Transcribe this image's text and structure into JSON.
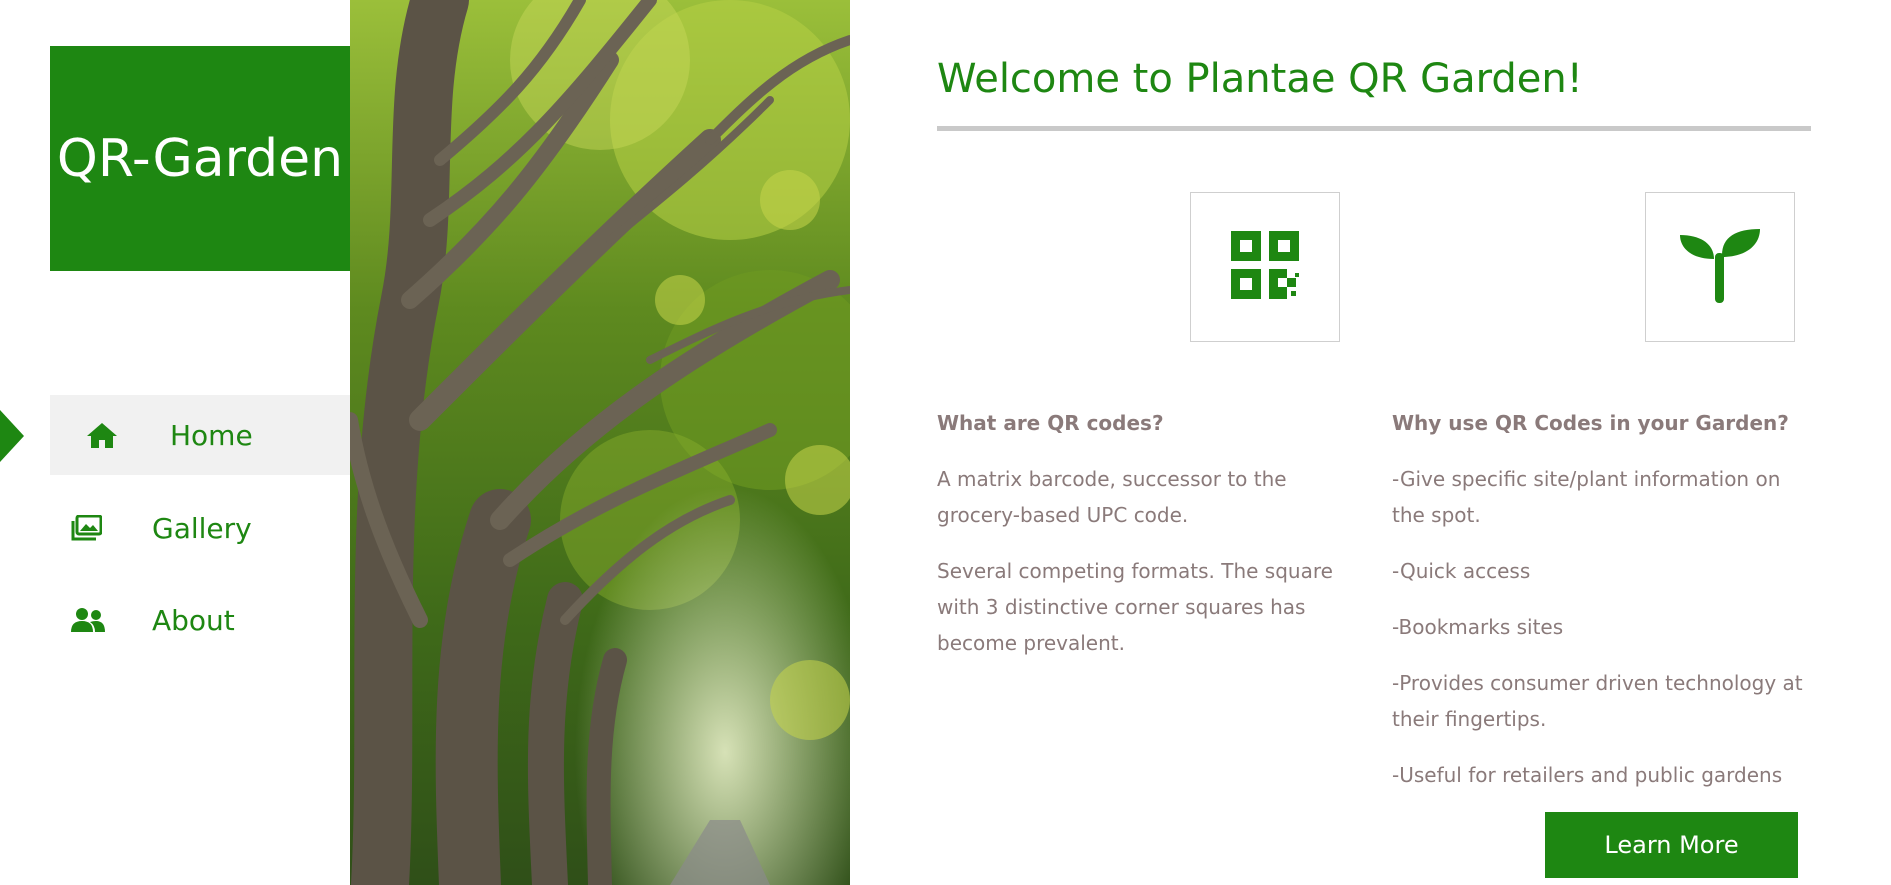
{
  "brand": {
    "title": "QR-Garden"
  },
  "nav": {
    "items": [
      {
        "label": "Home",
        "icon": "home-icon",
        "active": true
      },
      {
        "label": "Gallery",
        "icon": "gallery-icon",
        "active": false
      },
      {
        "label": "About",
        "icon": "users-icon",
        "active": false
      }
    ]
  },
  "main": {
    "title": "Welcome to Plantae QR Garden!",
    "icons": [
      "qr-code-icon",
      "seedling-icon"
    ],
    "left": {
      "heading": "What are QR codes?",
      "paragraphs": [
        "A matrix barcode, successor to the grocery-based UPC code.",
        "Several competing formats. The square with 3 distinctive corner squares has become prevalent."
      ]
    },
    "right": {
      "heading": "Why use QR Codes in your Garden?",
      "paragraphs": [
        "-Give specific site/plant information on the spot.",
        "-Quick access",
        "-Bookmarks sites",
        "-Provides consumer driven technology at their fingertips.",
        "-Useful for retailers and public gardens"
      ]
    },
    "button_label": "Learn More"
  },
  "colors": {
    "accent": "#1e8712",
    "body_text": "#8a7a7a",
    "active_nav_bg": "#f1f1f1",
    "rule": "#c9c9c9"
  }
}
